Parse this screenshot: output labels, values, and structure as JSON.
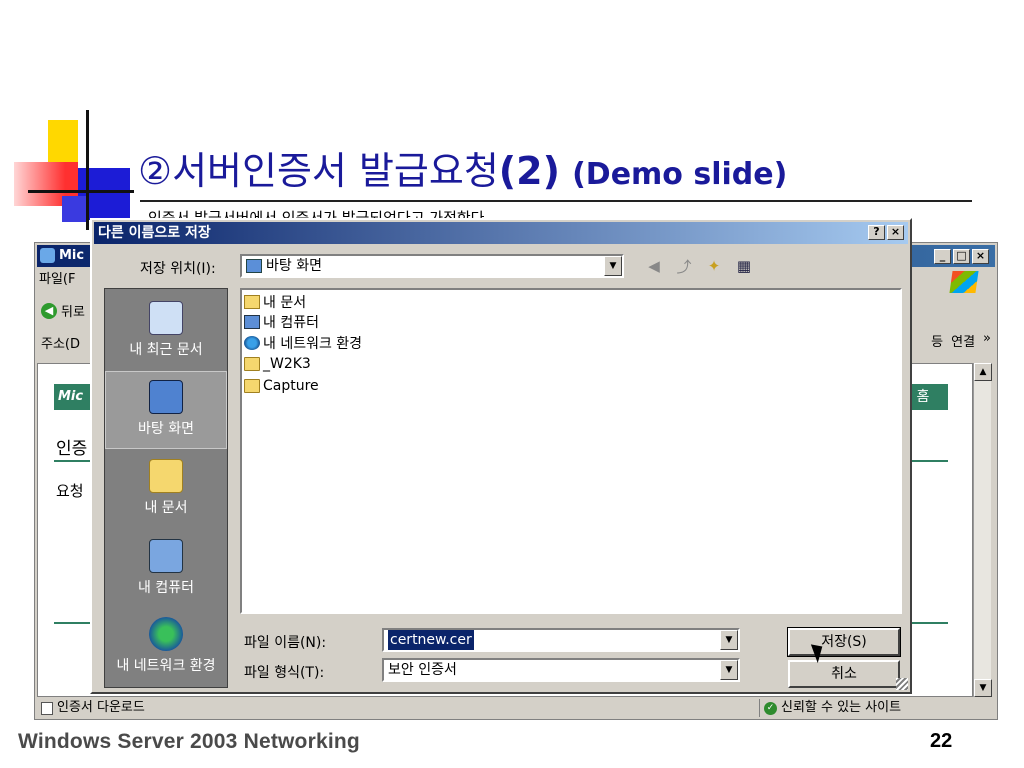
{
  "slide": {
    "title_prefix": "②서버인증서 발급요청",
    "title_num": "(2)",
    "title_demo": "(Demo slide)",
    "subtitle": "인증서 발급서버에서 인증서가 발급되었다고 가정한다",
    "footer_left": "Windows  Server 2003 Networking",
    "page_number": "22"
  },
  "ie": {
    "title": "Mic",
    "menu_file": "파일(F",
    "back_label": "뒤로",
    "address_label": "주소(D",
    "links_label1": "등",
    "links_label2": "연결",
    "links_more": "»",
    "brand": "Mic",
    "home": "홈",
    "heading": "인증",
    "request": "요청",
    "status_left": "인증서 다운로드",
    "status_right": "신뢰할 수 있는 사이트"
  },
  "dialog": {
    "title": "다른 이름으로 저장",
    "help_btn": "?",
    "close_btn": "×",
    "location_label": "저장 위치(I):",
    "location_value": "바탕 화면",
    "places": [
      {
        "label": "내 최근 문서",
        "icon": "recent-docs-icon"
      },
      {
        "label": "바탕 화면",
        "icon": "desktop-icon"
      },
      {
        "label": "내 문서",
        "icon": "my-documents-icon"
      },
      {
        "label": "내 컴퓨터",
        "icon": "my-computer-icon"
      },
      {
        "label": "내 네트워크 환경",
        "icon": "network-places-icon"
      }
    ],
    "files": [
      {
        "name": "내 문서",
        "icon": "my-documents-icon"
      },
      {
        "name": "내 컴퓨터",
        "icon": "my-computer-icon"
      },
      {
        "name": "내 네트워크 환경",
        "icon": "network-places-icon"
      },
      {
        "name": "_W2K3",
        "icon": "folder-icon"
      },
      {
        "name": "Capture",
        "icon": "folder-icon"
      }
    ],
    "filename_label": "파일 이름(N):",
    "filename_value": "certnew.cer",
    "filetype_label": "파일 형식(T):",
    "filetype_value": "보안 인증서",
    "save_label": "저장(S)",
    "cancel_label": "취소"
  }
}
